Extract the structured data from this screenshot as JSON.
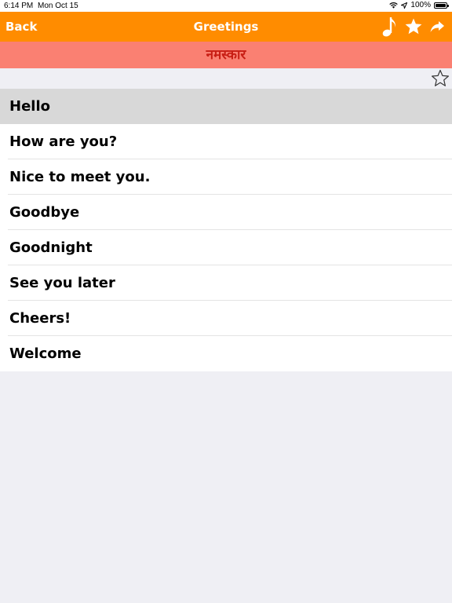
{
  "status_bar": {
    "time": "6:14 PM",
    "date": "Mon Oct 15",
    "battery": "100%",
    "battery_level": 1.0,
    "icons": [
      "wifi-icon",
      "location-arrow-icon",
      "battery-icon"
    ]
  },
  "nav": {
    "back_label": "Back",
    "title": "Greetings",
    "icons": [
      "music-note-icon",
      "star-icon",
      "share-icon"
    ]
  },
  "translation": "नमस्कार",
  "favorite_icon": "star-outline-icon",
  "phrases": [
    {
      "label": "Hello",
      "selected": true
    },
    {
      "label": "How are you?",
      "selected": false
    },
    {
      "label": "Nice to meet you.",
      "selected": false
    },
    {
      "label": "Goodbye",
      "selected": false
    },
    {
      "label": "Goodnight",
      "selected": false
    },
    {
      "label": "See you later",
      "selected": false
    },
    {
      "label": "Cheers!",
      "selected": false
    },
    {
      "label": "Welcome",
      "selected": false
    }
  ],
  "colors": {
    "nav_bar": "#ff8c00",
    "translation_bar": "#fa8072",
    "translation_text": "#c81e14",
    "selected_row": "#d8d8d8",
    "background": "#efeff4"
  }
}
